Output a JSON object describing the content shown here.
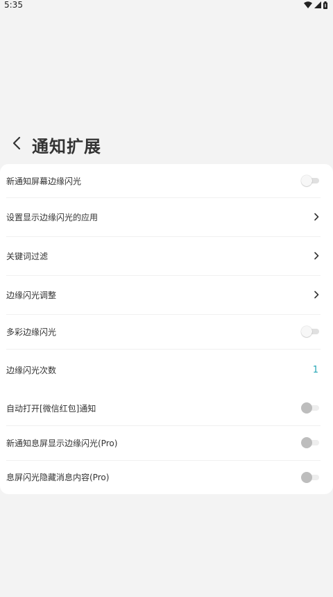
{
  "status_bar": {
    "time": "5:35",
    "icons": [
      "wifi-icon",
      "cellular-signal-icon",
      "battery-icon"
    ]
  },
  "header": {
    "title": "通知扩展",
    "back_icon": "back-arrow-icon"
  },
  "settings": [
    {
      "label": "新通知屏幕边缘闪光",
      "control": "toggle",
      "state": "off",
      "enabled": true
    },
    {
      "label": "设置显示边缘闪光的应用",
      "control": "chevron"
    },
    {
      "label": "关键词过滤",
      "control": "chevron"
    },
    {
      "label": "边缘闪光调整",
      "control": "chevron"
    },
    {
      "label": "多彩边缘闪光",
      "control": "toggle",
      "state": "off",
      "enabled": true
    },
    {
      "label": "边缘闪光次数",
      "control": "value",
      "value": "1"
    },
    {
      "label": "自动打开[微信红包]通知",
      "control": "toggle",
      "state": "off",
      "enabled": false
    },
    {
      "label": "新通知息屏显示边缘闪光(Pro)",
      "control": "toggle",
      "state": "off",
      "enabled": false
    },
    {
      "label": "息屏闪光隐藏消息内容(Pro)",
      "control": "toggle",
      "state": "off",
      "enabled": false
    }
  ],
  "colors": {
    "background": "#f3f3f3",
    "card": "#ffffff",
    "value_accent": "#22a5b5",
    "toggle_disabled_knob": "#bdbdbd"
  }
}
